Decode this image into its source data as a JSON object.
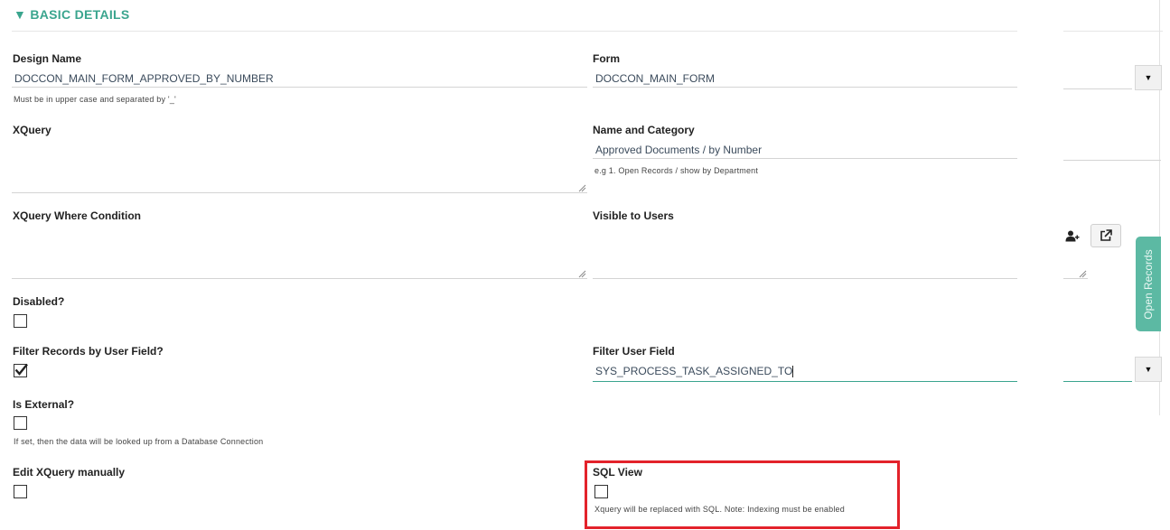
{
  "section": {
    "title": "▼ BASIC DETAILS"
  },
  "fields": {
    "design_name": {
      "label": "Design Name",
      "value": "DOCCON_MAIN_FORM_APPROVED_BY_NUMBER",
      "hint": "Must be in upper case and separated by '_'"
    },
    "form": {
      "label": "Form",
      "value": "DOCCON_MAIN_FORM"
    },
    "xquery": {
      "label": "XQuery",
      "value": ""
    },
    "name_category": {
      "label": "Name and Category",
      "value": "Approved Documents / by Number",
      "hint": "e.g 1. Open Records / show by Department"
    },
    "xquery_where": {
      "label": "XQuery Where Condition",
      "value": ""
    },
    "visible_users": {
      "label": "Visible to Users",
      "value": ""
    },
    "disabled": {
      "label": "Disabled?",
      "checked": false
    },
    "filter_records": {
      "label": "Filter Records by User Field?",
      "checked": true
    },
    "filter_user_field": {
      "label": "Filter User Field",
      "value": "SYS_PROCESS_TASK_ASSIGNED_TO"
    },
    "is_external": {
      "label": "Is External?",
      "checked": false,
      "hint": "If set, then the data will be looked up from a Database Connection"
    },
    "edit_xquery": {
      "label": "Edit XQuery manually",
      "checked": false
    },
    "sql_view": {
      "label": "SQL View",
      "checked": false,
      "hint": "Xquery will be replaced with SQL. Note: Indexing must be enabled"
    }
  },
  "side_tab": {
    "label": "Open Records"
  },
  "icons": {
    "dropdown": "caret-down-icon",
    "add_user": "add-user-icon",
    "external_link": "external-link-icon"
  },
  "colors": {
    "accent": "#3aa58e",
    "side_tab": "#5cb9a3",
    "highlight": "#e3222b"
  }
}
